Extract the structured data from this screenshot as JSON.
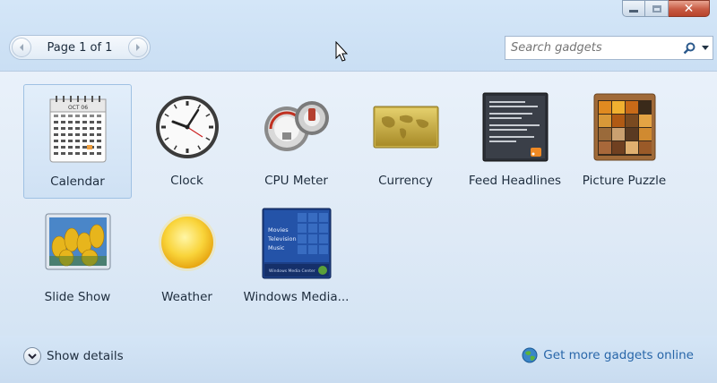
{
  "window": {
    "minimize_label": "",
    "maximize_label": "",
    "close_label": "✕"
  },
  "pager": {
    "text": "Page 1 of 1",
    "prev_icon": "chevron-left",
    "next_icon": "chevron-right"
  },
  "search": {
    "placeholder": "Search gadgets",
    "value": ""
  },
  "gadgets": [
    {
      "label": "Calendar",
      "icon": "calendar-icon",
      "selected": true,
      "cal_month": "OCT 06"
    },
    {
      "label": "Clock",
      "icon": "clock-icon"
    },
    {
      "label": "CPU Meter",
      "icon": "cpu-meter-icon"
    },
    {
      "label": "Currency",
      "icon": "currency-icon"
    },
    {
      "label": "Feed Headlines",
      "icon": "feed-headlines-icon"
    },
    {
      "label": "Picture Puzzle",
      "icon": "picture-puzzle-icon"
    },
    {
      "label": "Slide Show",
      "icon": "slide-show-icon"
    },
    {
      "label": "Weather",
      "icon": "weather-icon"
    },
    {
      "label": "Windows Media...",
      "icon": "windows-media-icon",
      "media_menu": [
        "Movies",
        "Television",
        "Music"
      ],
      "media_footer": "Windows Media Center"
    }
  ],
  "footer": {
    "details_label": "Show details",
    "online_label": "Get more gadgets online"
  },
  "colors": {
    "selection": "#cfe1f4",
    "link": "#2866a9",
    "close_button": "#c75a43"
  }
}
